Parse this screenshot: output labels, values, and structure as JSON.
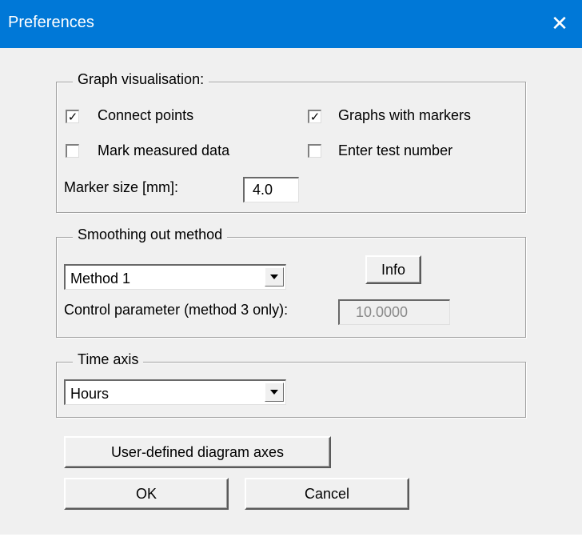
{
  "window": {
    "title": "Preferences",
    "close_glyph": "✕",
    "titlebar_color": "#0078d7"
  },
  "graph": {
    "legend": "Graph visualisation:",
    "connect_points": {
      "label": "Connect points",
      "checked": true
    },
    "graphs_with_markers": {
      "label": "Graphs with markers",
      "checked": true
    },
    "mark_measured_data": {
      "label": "Mark measured data",
      "checked": false
    },
    "enter_test_number": {
      "label": "Enter test number",
      "checked": false
    },
    "marker_size_label": "Marker size [mm]:",
    "marker_size_value": "4.0"
  },
  "smoothing": {
    "legend": "Smoothing out method",
    "method_selected": "Method 1",
    "info_label": "Info",
    "control_param_label": "Control parameter (method 3 only):",
    "control_param_value": "10.0000"
  },
  "time_axis": {
    "legend": "Time axis",
    "selected": "Hours"
  },
  "buttons": {
    "user_defined_axes": "User-defined diagram axes",
    "ok": "OK",
    "cancel": "Cancel"
  },
  "icons": {
    "check": "check-icon",
    "dropdown": "chevron-down-icon",
    "close": "close-icon"
  }
}
